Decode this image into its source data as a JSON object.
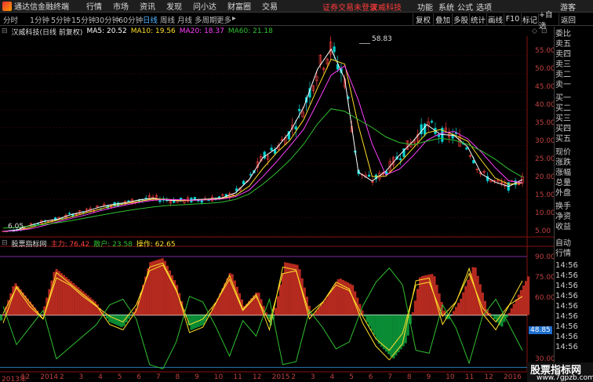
{
  "app": {
    "title": "通达信金融终端",
    "menu": [
      "行情",
      "市场",
      "资讯",
      "发现",
      "问小达",
      "财富圈",
      "交易"
    ],
    "notice_login": "证券交易未登录",
    "notice_stock": "汉威科技",
    "right_menu": [
      "功能",
      "系统",
      "公式",
      "选项"
    ],
    "user": "游客"
  },
  "period_tabs": [
    "分时",
    "1分钟",
    "5分钟",
    "15分钟",
    "30分钟",
    "60分钟",
    "日线",
    "周线",
    "月线",
    "多周期",
    "更多"
  ],
  "active_period": "日线",
  "tool_buttons": [
    "复权",
    "叠加",
    "多股",
    "统计",
    "画线",
    "F10",
    "标记",
    "+自选",
    "返回"
  ],
  "stock_header": "汉威科技(日线 前复权)",
  "ma": [
    {
      "label": "MA5: 20.52",
      "color": "#ffffff"
    },
    {
      "label": "MA10: 19.56",
      "color": "#ffdf2a"
    },
    {
      "label": "MA20: 18.37",
      "color": "#ff40ff"
    },
    {
      "label": "MA60: 21.18",
      "color": "#30c030"
    }
  ],
  "price_axis": [
    "55.00",
    "50.00",
    "45.00",
    "40.00",
    "35.00",
    "30.00",
    "25.00",
    "20.00",
    "15.00",
    "10.00",
    "5.00"
  ],
  "high_label": "58.83",
  "low_label": "6.05",
  "indicator": {
    "name": "股票指标网",
    "items": [
      {
        "label": "主力: 76.42",
        "color": "#ff4040"
      },
      {
        "label": "散户: 23.58",
        "color": "#30c030"
      },
      {
        "label": "操作: 62.65",
        "color": "#ffdf2a"
      }
    ],
    "axis": [
      "90.00",
      "75.00",
      "60.00",
      "45.00",
      "30.00",
      "15.00"
    ],
    "current_tag": "48.85"
  },
  "date_axis": [
    "2013年",
    "12",
    "2014",
    "2",
    "3",
    "4",
    "5",
    "6",
    "7",
    "8",
    "9",
    "10",
    "11",
    "12",
    "2015",
    "2",
    "3",
    "4",
    "5",
    "6",
    "7",
    "8",
    "9",
    "10",
    "11",
    "12",
    "2016"
  ],
  "sidebar": [
    "委比",
    "卖五",
    "卖四",
    "卖三",
    "卖二",
    "卖一",
    "买一",
    "买二",
    "买三",
    "买四",
    "买五",
    "现价",
    "涨跌",
    "涨幅",
    "总量",
    "外盘",
    "换手",
    "净资",
    "收益",
    "",
    "自动",
    "行情",
    "14:56",
    "14:56",
    "14:56",
    "14:56",
    "14:56",
    "14:56",
    "14:56",
    "14:56",
    "14:56",
    "14:56"
  ],
  "watermark": {
    "title": "股票指标网",
    "url": "www.7gpzb.com"
  },
  "colors": {
    "up": "#ff4040",
    "down": "#00d0d0",
    "ma5": "#ffffff",
    "ma10": "#ffdf2a",
    "ma20": "#ff40ff",
    "ma60": "#30c030",
    "bull": "#b52a1f",
    "bear": "#0a8c35"
  },
  "chart_data": {
    "type": "line",
    "title": "汉威科技(日线 前复权)",
    "ylim": [
      5,
      60
    ],
    "x_range": [
      "2013-11",
      "2016-01"
    ],
    "series": [
      {
        "name": "MA5: 20.52",
        "values": [
          6.1,
          6.5,
          7.8,
          8.9,
          9.5,
          10.8,
          11.6,
          12.8,
          13.6,
          14.1,
          14.9,
          15.3,
          14.8,
          14.6,
          14.9,
          15.1,
          15.4,
          16.8,
          20.5,
          26.6,
          29.2,
          33.8,
          40.7,
          51.2,
          56.8,
          48.5,
          22.6,
          20.1,
          22.8,
          27.3,
          31.2,
          35.8,
          33.1,
          32.8,
          29.6,
          22.1,
          19.8,
          18.6,
          20.5
        ]
      },
      {
        "name": "MA60: 21.18",
        "values": [
          7.0,
          7.2,
          7.6,
          8.0,
          8.5,
          9.1,
          9.8,
          10.5,
          11.2,
          11.8,
          12.4,
          12.9,
          13.3,
          13.5,
          13.7,
          13.9,
          14.2,
          15.0,
          16.5,
          19.2,
          22.4,
          26.0,
          30.4,
          36.0,
          40.2,
          39.5,
          37.2,
          35.0,
          32.4,
          30.8,
          30.2,
          31.2,
          32.0,
          31.5,
          30.3,
          28.5,
          26.2,
          23.4,
          21.2
        ]
      }
    ],
    "indicator_series": [
      {
        "name": "主力: 76.42",
        "values": [
          45,
          72,
          60,
          48,
          82,
          74,
          66,
          58,
          44,
          40,
          54,
          86,
          89,
          70,
          38,
          42,
          60,
          80,
          55,
          66,
          40,
          86,
          84,
          48,
          60,
          75,
          70,
          45,
          28,
          18,
          30,
          76,
          78,
          44,
          60,
          85,
          52,
          40,
          58,
          76
        ]
      },
      {
        "name": "散户: 23.58",
        "values": [
          55,
          28,
          40,
          52,
          18,
          26,
          34,
          42,
          56,
          60,
          46,
          14,
          11,
          30,
          62,
          58,
          40,
          20,
          45,
          34,
          60,
          14,
          16,
          52,
          40,
          25,
          30,
          55,
          72,
          82,
          70,
          24,
          22,
          56,
          40,
          15,
          48,
          60,
          42,
          24
        ]
      },
      {
        "name": "操作: 62.65",
        "values": [
          50,
          68,
          55,
          46,
          75,
          70,
          62,
          55,
          48,
          44,
          56,
          80,
          84,
          66,
          42,
          46,
          58,
          74,
          52,
          62,
          44,
          78,
          80,
          50,
          58,
          70,
          66,
          48,
          32,
          24,
          36,
          70,
          72,
          48,
          58,
          78,
          54,
          44,
          56,
          62
        ]
      }
    ],
    "indicator_ylim": [
      10,
      95
    ]
  }
}
